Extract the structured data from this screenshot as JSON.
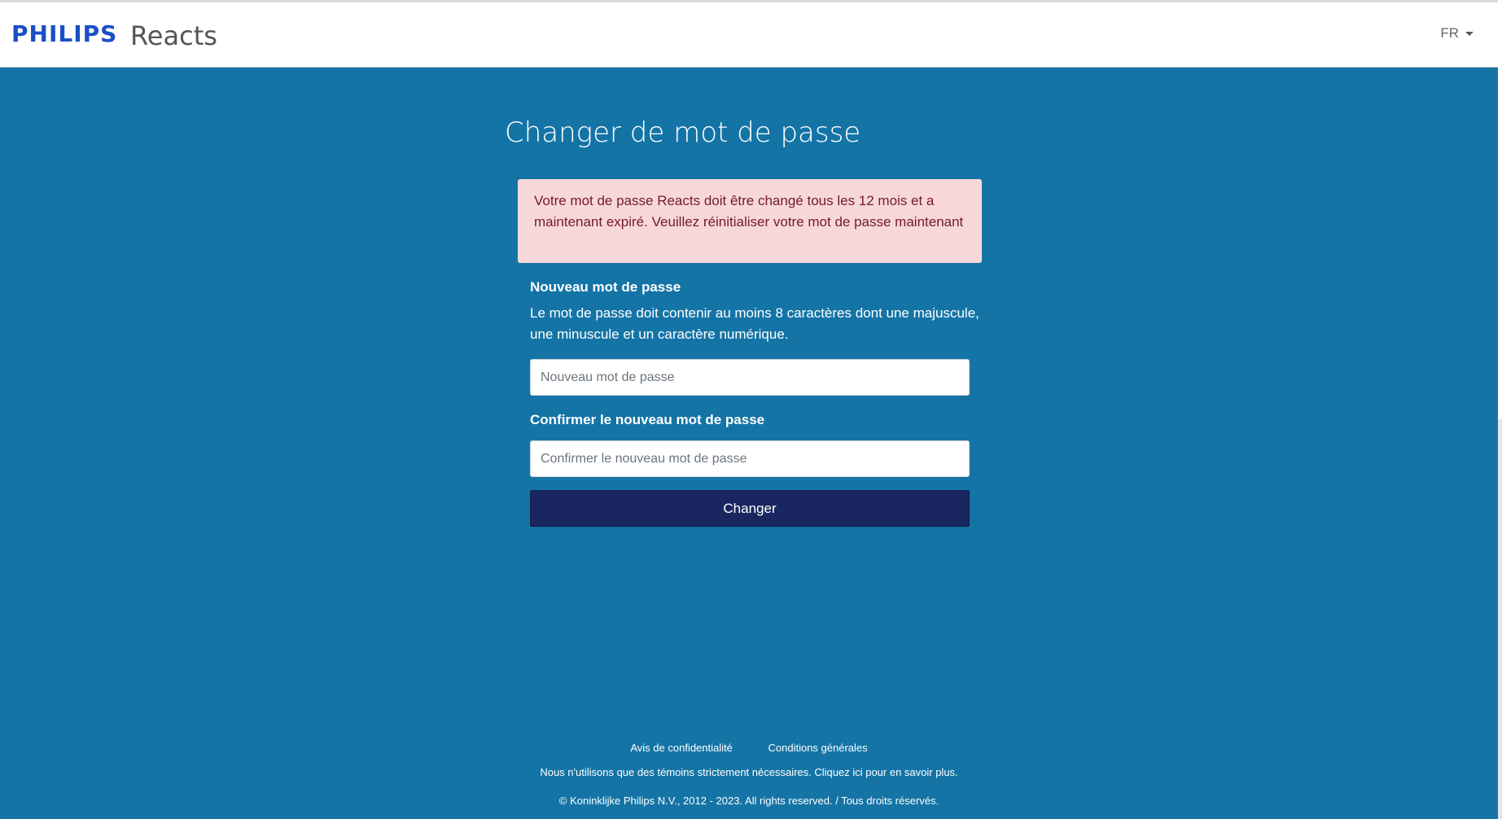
{
  "header": {
    "brand": "PHILIPS",
    "product": "Reacts",
    "language": "FR"
  },
  "main": {
    "title": "Changer de mot de passe",
    "alert": "Votre mot de passe Reacts doit être changé tous les 12 mois et a maintenant expiré. Veuillez réinitialiser votre mot de passe maintenant",
    "new_password_label": "Nouveau mot de passe",
    "new_password_help": "Le mot de passe doit contenir au moins 8 caractères dont une majuscule, une minuscule et un caractère numérique.",
    "new_password_placeholder": "Nouveau mot de passe",
    "new_password_value": "",
    "confirm_label": "Confirmer le nouveau mot de passe",
    "confirm_placeholder": "Confirmer le nouveau mot de passe",
    "confirm_value": "",
    "submit_label": "Changer"
  },
  "footer": {
    "privacy_link": "Avis de confidentialité",
    "terms_link": "Conditions générales",
    "cookies_notice": "Nous n'utilisons que des témoins strictement nécessaires. Cliquez ici pour en savoir plus.",
    "copyright": "© Koninklijke Philips N.V., 2012 - 2023. All rights reserved. / Tous droits réservés."
  },
  "colors": {
    "page_background": "#1474a6",
    "brand_blue": "#1a4fc4",
    "alert_background": "#f8d7da",
    "alert_text": "#721c24",
    "button_background": "#1a2660"
  },
  "icons": {
    "language_caret": "caret-down-icon"
  }
}
